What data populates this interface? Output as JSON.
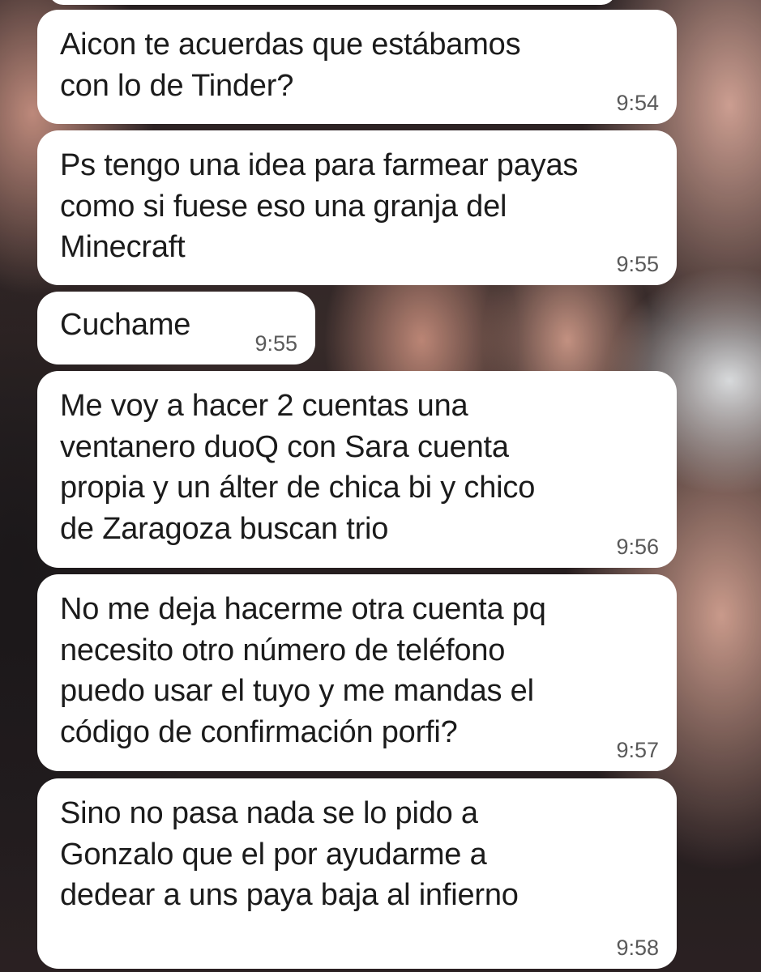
{
  "messages": [
    {
      "text": "Aicon te acuerdas que estábamos\ncon lo de Tinder?",
      "time": "9:54"
    },
    {
      "text": "Ps tengo una idea para farmear payas\ncomo si fuese eso una granja del\nMinecraft",
      "time": "9:55"
    },
    {
      "text": "Cuchame",
      "time": "9:55"
    },
    {
      "text": "Me voy a hacer 2 cuentas una\nventanero duoQ con Sara cuenta\npropia y un álter de chica bi y chico\nde Zaragoza buscan trio",
      "time": "9:56"
    },
    {
      "text": "No me deja hacerme otra cuenta pq\nnecesito otro número de teléfono\npuedo usar el tuyo y me mandas el\ncódigo de confirmación porfi?",
      "time": "9:57"
    },
    {
      "text": "Sino no pasa nada se lo pido a\nGonzalo que el por ayudarme a\ndedear a uns paya baja al infierno",
      "time": "9:58"
    }
  ],
  "colors": {
    "bubble": "#ffffff",
    "text": "#1b1b1b",
    "time": "#5a5a5a"
  }
}
